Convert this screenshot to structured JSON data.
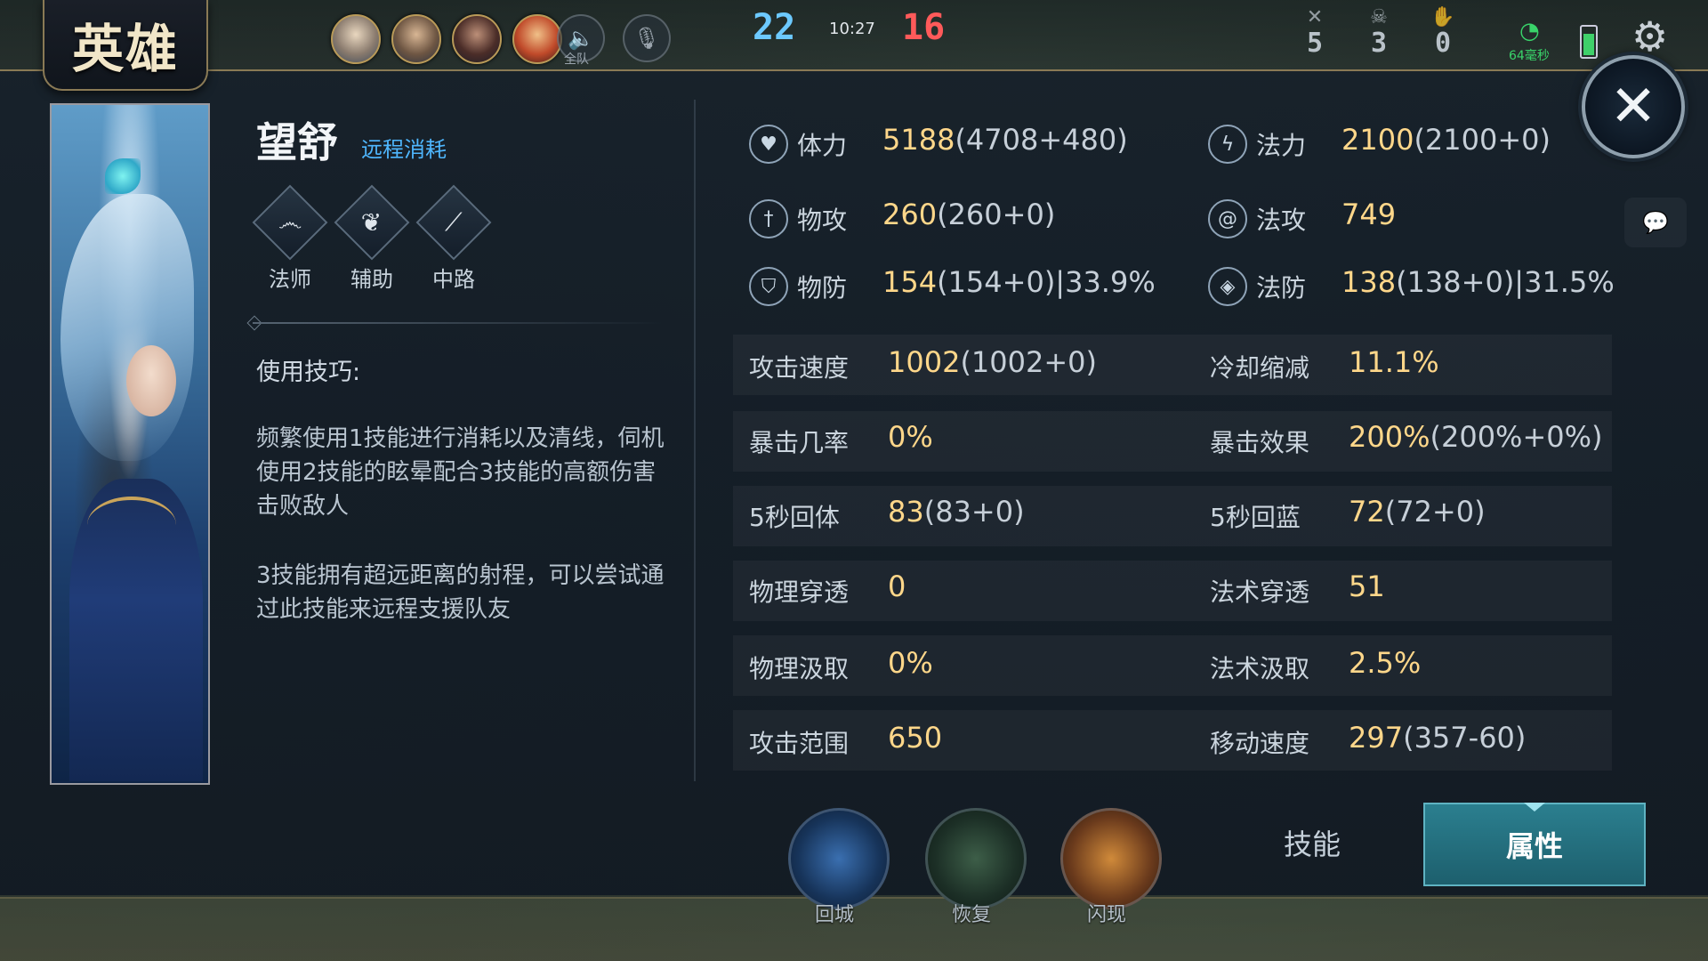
{
  "header": {
    "title": "英雄",
    "voice_label": "全队",
    "score_blue": "22",
    "score_red": "16",
    "game_time": "10:27",
    "kills": "5",
    "deaths": "3",
    "assists": "0",
    "net_speed": "64毫秒"
  },
  "hero": {
    "name": "望舒",
    "tag": "远程消耗",
    "roles": [
      {
        "label": "法师",
        "icon": "mage-icon"
      },
      {
        "label": "辅助",
        "icon": "support-icon"
      },
      {
        "label": "中路",
        "icon": "mid-lane-icon"
      }
    ],
    "tips_title": "使用技巧:",
    "tips": [
      "频繁使用1技能进行消耗以及清线，伺机使用2技能的眩晕配合3技能的高额伤害击败敌人",
      "3技能拥有超远距离的射程，可以尝试通过此技能来远程支援队友"
    ]
  },
  "stats_top": [
    {
      "label": "体力",
      "value": "5188",
      "sub": "(4708+480)",
      "icon": "heart-icon"
    },
    {
      "label": "法力",
      "value": "2100",
      "sub": "(2100+0)",
      "icon": "lightning-icon"
    },
    {
      "label": "物攻",
      "value": "260",
      "sub": "(260+0)",
      "icon": "sword-icon"
    },
    {
      "label": "法攻",
      "value": "749",
      "sub": "",
      "icon": "spiral-icon"
    },
    {
      "label": "物防",
      "value": "154",
      "sub": "(154+0)|33.9%",
      "icon": "shield-icon"
    },
    {
      "label": "法防",
      "value": "138",
      "sub": "(138+0)|31.5%",
      "icon": "magic-shield-icon"
    }
  ],
  "stats_rows": [
    {
      "left_label": "攻击速度",
      "left_value": "1002",
      "left_sub": "(1002+0)",
      "right_label": "冷却缩减",
      "right_value": "11.1%",
      "right_sub": ""
    },
    {
      "left_label": "暴击几率",
      "left_value": "0%",
      "left_sub": "",
      "right_label": "暴击效果",
      "right_value": "200%",
      "right_sub": "(200%+0%)"
    },
    {
      "left_label": "5秒回体",
      "left_value": "83",
      "left_sub": "(83+0)",
      "right_label": "5秒回蓝",
      "right_value": "72",
      "right_sub": "(72+0)"
    },
    {
      "left_label": "物理穿透",
      "left_value": "0",
      "left_sub": "",
      "right_label": "法术穿透",
      "right_value": "51",
      "right_sub": ""
    },
    {
      "left_label": "物理汲取",
      "left_value": "0%",
      "left_sub": "",
      "right_label": "法术汲取",
      "right_value": "2.5%",
      "right_sub": ""
    },
    {
      "left_label": "攻击范围",
      "left_value": "650",
      "left_sub": "",
      "right_label": "移动速度",
      "right_value": "297",
      "right_sub": "(357-60)"
    }
  ],
  "bottom": {
    "skill_recall": "回城",
    "skill_heal": "恢复",
    "skill_flash": "闪现",
    "tab_skills": "技能",
    "tab_attributes": "属性"
  }
}
